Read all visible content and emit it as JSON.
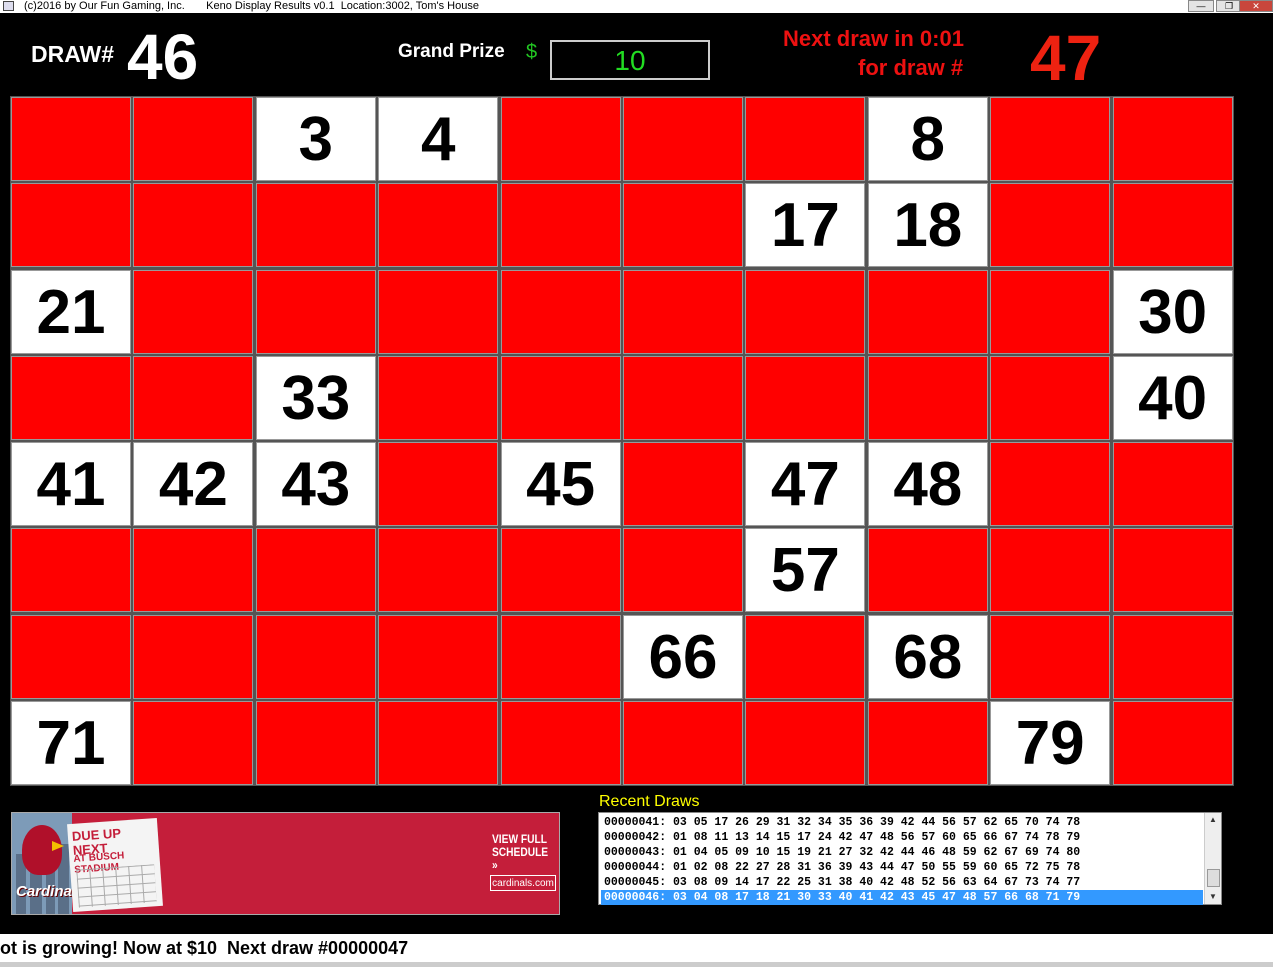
{
  "window": {
    "title": "(c)2016 by Our Fun Gaming, Inc.       Keno Display Results v0.1  Location:3002, Tom's House",
    "minimize_glyph": "—",
    "maximize_glyph": "❐",
    "close_glyph": "✕"
  },
  "header": {
    "draw_label": "DRAW#",
    "draw_number": "46",
    "grand_prize_label": "Grand Prize",
    "grand_prize_currency": "$",
    "grand_prize_value": "10",
    "next_draw_line1": "Next draw in 0:01",
    "next_draw_line2": "for draw #",
    "next_draw_number": "47"
  },
  "board": {
    "rows": 8,
    "cols": 10,
    "drawn_numbers": [
      3,
      4,
      8,
      17,
      18,
      21,
      30,
      33,
      40,
      41,
      42,
      43,
      45,
      47,
      48,
      57,
      66,
      68,
      71,
      79
    ],
    "colors": {
      "drawn": "#ffffff",
      "not_drawn": "#ff0000"
    }
  },
  "ad": {
    "headline": "DUE UP NEXT",
    "subheadline": "AT BUSCH STADIUM",
    "cta": "VIEW FULL SCHEDULE »",
    "site": "cardinals.com",
    "logo": "Cardinals"
  },
  "recent_draws": {
    "label": "Recent Draws",
    "rows": [
      "00000041: 03 05 17 26 29 31 32 34 35 36 39 42 44 56 57 62 65 70 74 78",
      "00000042: 01 08 11 13 14 15 17 24 42 47 48 56 57 60 65 66 67 74 78 79",
      "00000043: 01 04 05 09 10 15 19 21 27 32 42 44 46 48 59 62 67 69 74 80",
      "00000044: 01 02 08 22 27 28 31 36 39 43 44 47 50 55 59 60 65 72 75 78",
      "00000045: 03 08 09 14 17 22 25 31 38 40 42 48 52 56 63 64 67 73 74 77",
      "00000046: 03 04 08 17 18 21 30 33 40 41 42 43 45 47 48 57 66 68 71 79"
    ],
    "selected_index": 5
  },
  "ticker": {
    "text": "ot is growing! Now at $10  Next draw #00000047"
  }
}
